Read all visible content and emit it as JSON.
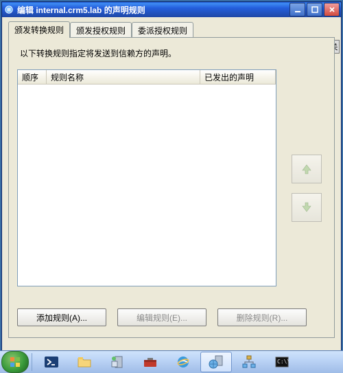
{
  "window": {
    "title": "编辑 internal.crm5.lab 的声明规则"
  },
  "tabs": {
    "t0": "颁发转换规则",
    "t1": "颁发授权规则",
    "t2": "委派授权规则"
  },
  "panel": {
    "description": "以下转换规则指定将发送到信赖方的声明。"
  },
  "columns": {
    "order": "顺序",
    "name": "规则名称",
    "issued": "已发出的声明"
  },
  "buttons": {
    "add": "添加规则(A)...",
    "edit": "编辑规则(E)...",
    "delete": "删除规则(R)..."
  },
  "close_float": "关",
  "taskbar": {
    "items": [
      "powershell",
      "explorer",
      "server-manager",
      "toolbox",
      "ie",
      "adfs",
      "network",
      "cmd"
    ]
  }
}
